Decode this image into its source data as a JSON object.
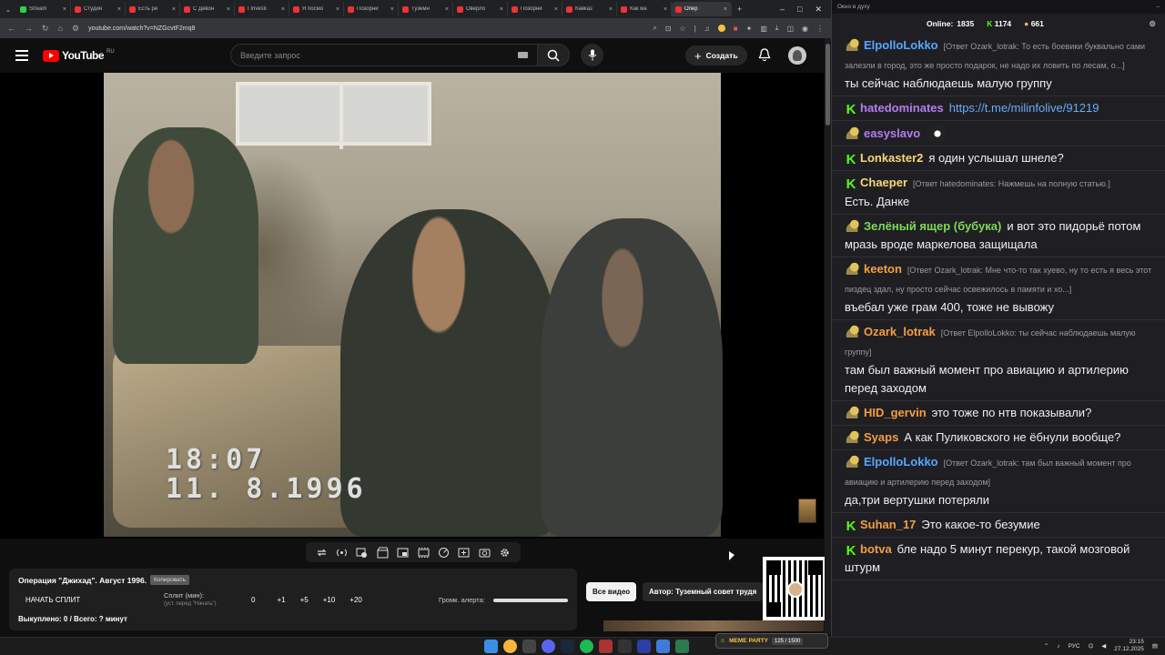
{
  "browser": {
    "tabs": [
      {
        "label": "Stream",
        "fav": "green"
      },
      {
        "label": "Студия",
        "fav": "red"
      },
      {
        "label": "Есть ре",
        "fav": "red"
      },
      {
        "label": "С Девон",
        "fav": "red"
      },
      {
        "label": "I Investi",
        "fav": "red"
      },
      {
        "label": "Я посмо",
        "fav": "red"
      },
      {
        "label": "Позорни",
        "fav": "red"
      },
      {
        "label": "Туземн",
        "fav": "red"
      },
      {
        "label": "Оверло",
        "fav": "red"
      },
      {
        "label": "Позорни",
        "fav": "red"
      },
      {
        "label": "Кавказ",
        "fav": "red"
      },
      {
        "label": "Как ма",
        "fav": "red"
      },
      {
        "label": "Опер",
        "fav": "red"
      }
    ],
    "url": "youtube.com/watch?v=NZGcvtF2mq8"
  },
  "youtube": {
    "logo_text": "YouTube",
    "region": "RU",
    "search_placeholder": "Введите запрос",
    "create_label": "Создать"
  },
  "video": {
    "timestamp_time": "18:07",
    "timestamp_date": "11. 8.1996"
  },
  "panel": {
    "title": "Операция \"Джихад\". Август 1996.",
    "copy_label": "Копировать",
    "start_split": "НАЧАТЬ СПЛИТ",
    "split_label": "Сплит (мин):",
    "split_hint": "(уст. перед \"Начать\")",
    "split_value": "0",
    "steps": [
      "+1",
      "+5",
      "+10",
      "+20"
    ],
    "volume_label": "Громк. алерта:",
    "footer": "Выкуплено: 0 / Всего: ? минут"
  },
  "below": {
    "all_videos": "Все видео",
    "author": "Автор: Туземный совет трудя"
  },
  "chat": {
    "window_title": "Окно в духу",
    "online_label": "Online:",
    "online_value": "1835",
    "kick_count": "1174",
    "hat_count": "661",
    "messages": [
      {
        "badge": "hat",
        "user": "ElpolloLokko",
        "color": "#58a6ff",
        "reply": "[Ответ Ozark_lotrak: То есть боевики буквально сами залезли в город, это же просто подарок, не надо их ловить по лесам, о...]",
        "text": "ты сейчас наблюдаешь малую группу"
      },
      {
        "badge": "k",
        "user": "hatedominates",
        "color": "#b57cf0",
        "reply": "",
        "text": "",
        "link": "https://t.me/milinfolive/91219"
      },
      {
        "badge": "hat",
        "user": "easyslavo",
        "color": "#b57cf0",
        "reply": "",
        "text": "",
        "emote": true
      },
      {
        "badge": "k",
        "user": "Lonkaster2",
        "color": "#f7d774",
        "reply": "",
        "text": "я один услышал шнеле?"
      },
      {
        "badge": "k",
        "user": "Chaeper",
        "color": "#f7d774",
        "reply": "[Ответ hatedominates: Нажмешь на полную статью.]",
        "text": "Есть. Данке"
      },
      {
        "badge": "hat",
        "user": "Зелёный ящер (бубука)",
        "color": "#7ed957",
        "reply": "",
        "text": "и вот это пидорьё потом мразь вроде маркелова защищала"
      },
      {
        "badge": "hat",
        "user": "keeton",
        "color": "#f59e42",
        "reply": "[Ответ Ozark_lotrak: Мне что-то так хуево, ну то есть я весь этот пиздец здал, ну просто сейчас освежилось в памяти и хо...]",
        "text": "въебал уже грам 400, тоже не вывожу"
      },
      {
        "badge": "hat",
        "user": "Ozark_lotrak",
        "color": "#f59e42",
        "reply": "[Ответ ElpolloLokko: ты сейчас наблюдаешь малую группу]",
        "text": "там был важный момент про авиацию и артилерию перед заходом"
      },
      {
        "badge": "hat",
        "user": "HID_gervin",
        "color": "#f59e42",
        "reply": "",
        "text": "это тоже по нтв показывали?"
      },
      {
        "badge": "hat",
        "user": "Syaps",
        "color": "#f59e42",
        "reply": "",
        "text": "А как Пуликовского не ёбнули вообще?"
      },
      {
        "badge": "hat",
        "user": "ElpolloLokko",
        "color": "#58a6ff",
        "reply": "[Ответ Ozark_lotrak: там был важный момент про авиацию и артилерию перед заходом]",
        "text": "да,три вертушки потеряли"
      },
      {
        "badge": "k",
        "user": "Suhan_17",
        "color": "#f59e42",
        "reply": "",
        "text": "Это какое-то безумие"
      },
      {
        "badge": "k",
        "user": "botva",
        "color": "#f59e42",
        "reply": "",
        "text": "бле надо 5 минут перекур, такой мозговой штурм"
      }
    ]
  },
  "overlay": {
    "meme_label": "MEME PARTY",
    "meme_progress": "125 / 1500"
  },
  "taskbar": {
    "lang": "РУС",
    "time": "23:15",
    "date": "27.12.2025"
  }
}
